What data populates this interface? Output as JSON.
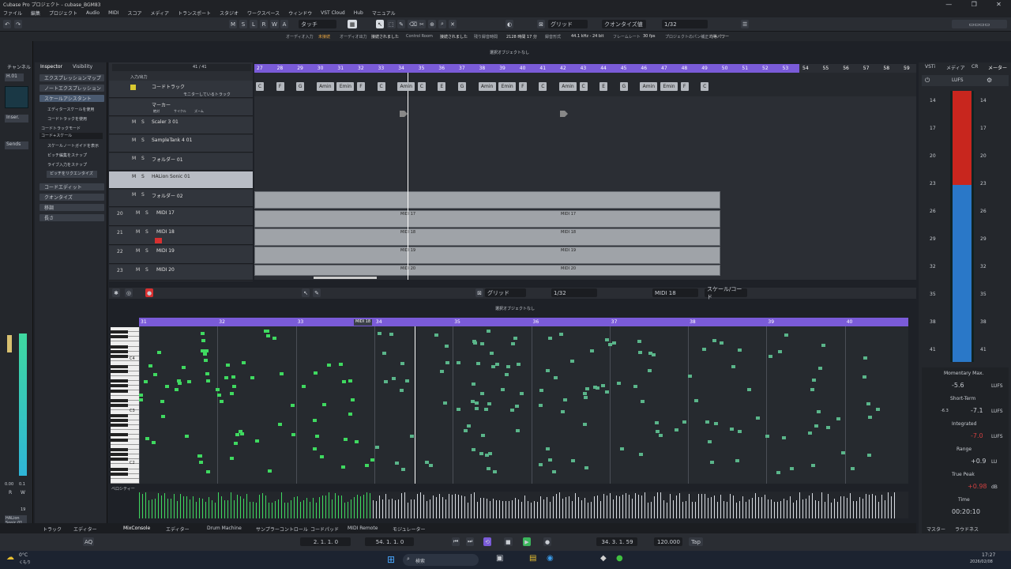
{
  "window": {
    "title": "Cubase Pro プロジェクト - cubase_BGM83"
  },
  "menu": [
    "ファイル",
    "編集",
    "プロジェクト",
    "Audio",
    "MIDI",
    "スコア",
    "メディア",
    "トランスポート",
    "スタジオ",
    "ワークスペース",
    "ウィンドウ",
    "VST Cloud",
    "Hub",
    "マニュアル"
  ],
  "toolbar": {
    "letters": [
      "M",
      "S",
      "L",
      "R",
      "W",
      "A"
    ],
    "automation_mode": "タッチ",
    "snap_type": "グリッド",
    "quantize_preset": "クオンタイズ値",
    "quantize_value": "1/32"
  },
  "info": {
    "items": [
      "オーディオ入力",
      "未接続",
      "オーディオ出力",
      "接続されました",
      "Control Room",
      "接続されました",
      "残り録音時間",
      "2128 時間 17 分",
      "録音形式",
      "44.1 kHz - 24 bit",
      "フレームレート",
      "30 fps",
      "プロジェクトのパン補正",
      "均等パワー"
    ],
    "status": "選択オブジェクトなし"
  },
  "leftzone": {
    "tab_channel": "チャンネル",
    "insert_button": "Inser.",
    "sends_button": "Sends",
    "channel_label": "H.01",
    "meter_scale": "0.00",
    "meter_val": "0.1",
    "bottom_labels": [
      "R",
      "W"
    ],
    "channel_name": "HALion Sonic 01",
    "number": "19"
  },
  "inspector": {
    "tabs": [
      "Inspector",
      "Visibility"
    ],
    "sections": [
      "エクスプレッションマップ",
      "ノートエクスプレッション",
      "スケールアシスタント",
      "コードエディット",
      "クオンタイズ",
      "移調",
      "長さ"
    ],
    "options": [
      "エディタースケールを使用",
      "コードトラックを使用",
      "コードトラックモード",
      "コード+スケール",
      "スケールノートガイドを表示",
      "ピッチ編集をスナップ",
      "ライブ入力をスナップ"
    ],
    "button": "ピッチをリクエンタイズ"
  },
  "tracklist": {
    "count": "41 / 41",
    "io": "入力/出力",
    "tracks": [
      {
        "name": "コードトラック"
      },
      {
        "name": "マーカー"
      },
      {
        "name": "Scaler 3 01"
      },
      {
        "name": "SampleTank 4 01"
      },
      {
        "name": "フォルダー 01"
      },
      {
        "name": "HALion Sonic 01"
      },
      {
        "name": "フォルダー 02"
      },
      {
        "name": "MIDI 17",
        "num": "20"
      },
      {
        "name": "MIDI 18",
        "num": "21"
      },
      {
        "name": "MIDI 19",
        "num": "22"
      },
      {
        "name": "MIDI 20",
        "num": "23"
      }
    ],
    "chord_monitor": "モニターしているトラック",
    "marker_labels": [
      "絶対",
      "サイクル",
      "ズーム"
    ],
    "chan_labels": [
      "チャンネル 1",
      "チャンネル 2"
    ]
  },
  "ruler": {
    "bars": [
      "27",
      "28",
      "29",
      "30",
      "31",
      "32",
      "33",
      "34",
      "35",
      "36",
      "37",
      "38",
      "39",
      "40",
      "41",
      "42",
      "43",
      "44",
      "45",
      "46",
      "47",
      "48",
      "49",
      "50",
      "51",
      "52",
      "53",
      "54",
      "55",
      "56",
      "57",
      "58",
      "59"
    ]
  },
  "chords": [
    [
      "C",
      0
    ],
    [
      "F",
      1
    ],
    [
      "G",
      2
    ],
    [
      "Amin",
      3
    ],
    [
      "Emin",
      4
    ],
    [
      "F",
      5
    ],
    [
      "C",
      6
    ],
    [
      "Amin",
      7
    ],
    [
      "C",
      8
    ],
    [
      "E",
      9
    ],
    [
      "G",
      10
    ],
    [
      "Amin",
      11
    ],
    [
      "Emin",
      12
    ],
    [
      "F",
      13
    ],
    [
      "C",
      14
    ],
    [
      "Amin",
      15
    ],
    [
      "C",
      16
    ],
    [
      "E",
      17
    ],
    [
      "G",
      18
    ],
    [
      "Amin",
      19
    ],
    [
      "Emin",
      20
    ],
    [
      "F",
      21
    ],
    [
      "C",
      22
    ]
  ],
  "parts": {
    "p1": "MIDI 17",
    "p2": "MIDI 18",
    "p3": "MIDI 19",
    "p4": "MIDI 20"
  },
  "editor": {
    "snap": "グリッド",
    "quant": "1/32",
    "track": "MIDI 18",
    "scale": "スケール/コード",
    "status": "選択オブジェクトなし",
    "bars": [
      "31",
      "32",
      "33",
      "34",
      "35",
      "36",
      "37",
      "38",
      "39",
      "40"
    ],
    "tag": "MIDI 18",
    "note_labels": [
      "C4",
      "C3",
      "C2"
    ],
    "velocity_label": "ベロシティー"
  },
  "right": {
    "tabs": [
      "VSTi",
      "メディア",
      "CR",
      "メーター"
    ],
    "unit": "LUFS",
    "scale": [
      "14",
      "17",
      "20",
      "23",
      "26",
      "29",
      "32",
      "35",
      "38",
      "41"
    ],
    "momentary_label": "Momentary Max.",
    "momentary": "-5.6",
    "momentary_unit": "LUFS",
    "short_label": "Short-Term",
    "short_pre": "-6.3",
    "short": "-7.1",
    "short_unit": "LUFS",
    "integrated_label": "Integrated",
    "integrated": "-7.0",
    "integrated_unit": "LUFS",
    "range_label": "Range",
    "range": "+0.9",
    "range_unit": "LU",
    "peak_label": "True Peak",
    "peak": "+0.98",
    "peak_unit": "dB",
    "time_label": "Time",
    "time": "00:20:10",
    "bottom_tabs": [
      "マスター",
      "ラウドネス"
    ]
  },
  "bottomtabs": [
    "トラック",
    "エディター",
    "MixConsole",
    "エディター",
    "Drum Machine",
    "サンプラーコントロール",
    "コードパッド",
    "MIDI Remote",
    "モジュレーター"
  ],
  "transport": {
    "left_locator": "2. 1. 1. 0",
    "right_locator": "54. 1. 1. 0",
    "position": "34. 3. 1. 59",
    "tempo": "120.000",
    "tap": "Tap",
    "aq": "AQ"
  },
  "taskbar": {
    "weather_temp": "0°C",
    "weather_text": "くもり",
    "search": "検索",
    "time": "17:27",
    "date": "2026/02/08"
  }
}
